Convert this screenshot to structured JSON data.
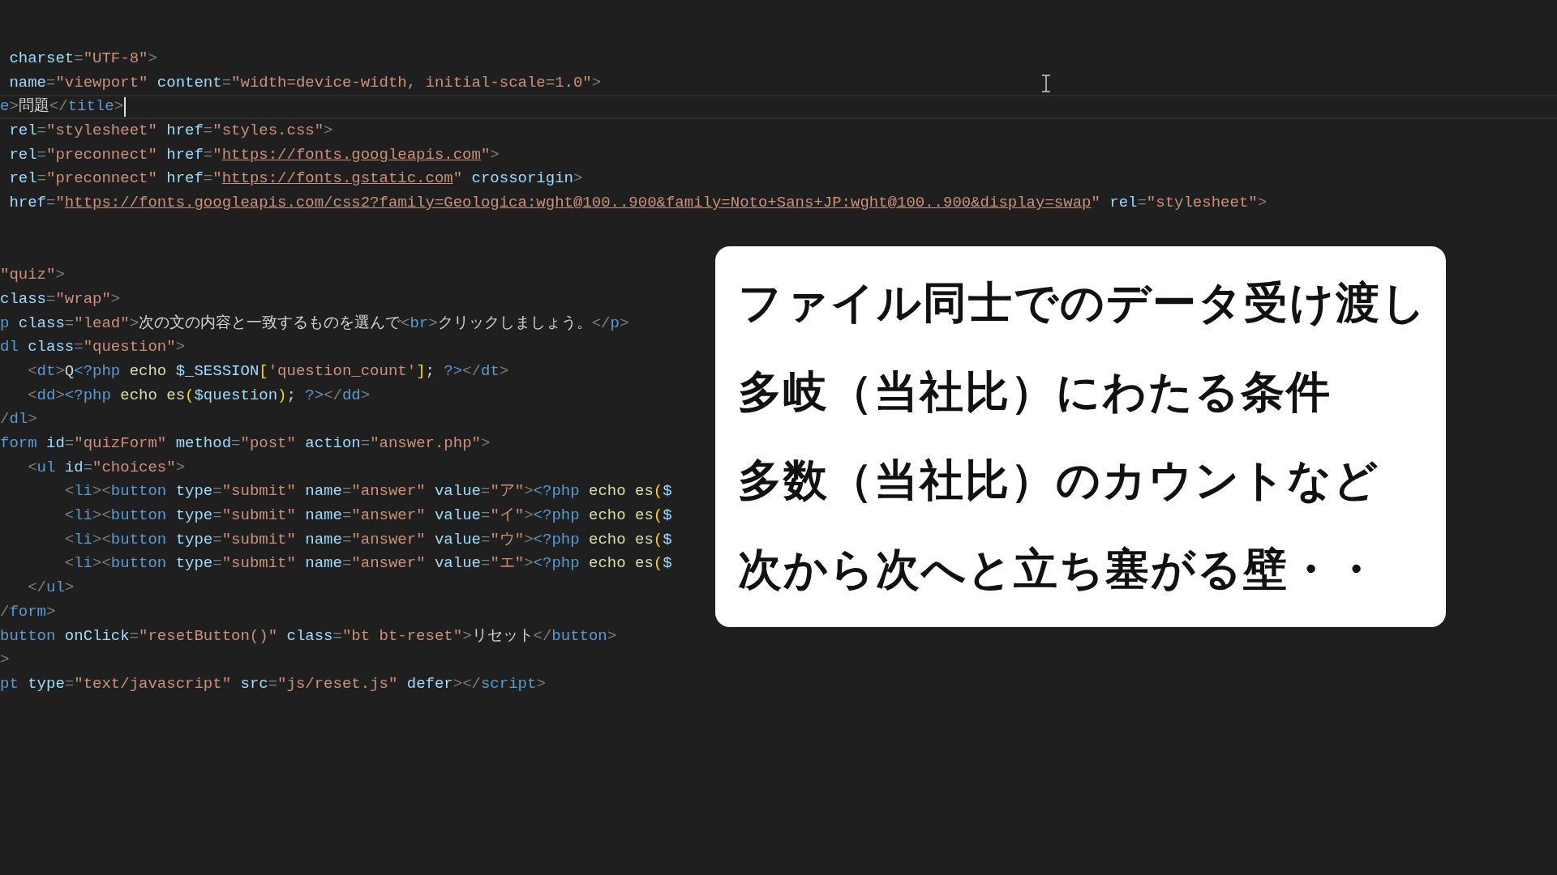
{
  "editor": {
    "code_blocks": [
      {
        "lines": [
          {
            "current": false,
            "segments": [
              {
                "kind": "attr",
                "text": " charset"
              },
              {
                "kind": "punct",
                "text": "="
              },
              {
                "kind": "str",
                "text": "\"UTF-8\""
              },
              {
                "kind": "punct",
                "text": ">"
              }
            ]
          },
          {
            "current": false,
            "segments": [
              {
                "kind": "attr",
                "text": " name"
              },
              {
                "kind": "punct",
                "text": "="
              },
              {
                "kind": "str",
                "text": "\"viewport\""
              },
              {
                "kind": "attr",
                "text": " content"
              },
              {
                "kind": "punct",
                "text": "="
              },
              {
                "kind": "str",
                "text": "\"width=device-width, initial-scale=1.0\""
              },
              {
                "kind": "punct",
                "text": ">"
              }
            ]
          },
          {
            "current": true,
            "segments": [
              {
                "kind": "tag",
                "text": "e"
              },
              {
                "kind": "punct",
                "text": ">"
              },
              {
                "kind": "plain",
                "text": "問題"
              },
              {
                "kind": "punct",
                "text": "</"
              },
              {
                "kind": "tag",
                "text": "title"
              },
              {
                "kind": "punct",
                "text": ">"
              }
            ]
          },
          {
            "current": false,
            "segments": [
              {
                "kind": "attr",
                "text": " rel"
              },
              {
                "kind": "punct",
                "text": "="
              },
              {
                "kind": "str",
                "text": "\"stylesheet\""
              },
              {
                "kind": "attr",
                "text": " href"
              },
              {
                "kind": "punct",
                "text": "="
              },
              {
                "kind": "str",
                "text": "\"styles.css\""
              },
              {
                "kind": "punct",
                "text": ">"
              }
            ]
          },
          {
            "current": false,
            "segments": [
              {
                "kind": "attr",
                "text": " rel"
              },
              {
                "kind": "punct",
                "text": "="
              },
              {
                "kind": "str",
                "text": "\"preconnect\""
              },
              {
                "kind": "attr",
                "text": " href"
              },
              {
                "kind": "punct",
                "text": "="
              },
              {
                "kind": "str",
                "text": "\""
              },
              {
                "kind": "link",
                "text": "https://fonts.googleapis.com"
              },
              {
                "kind": "str",
                "text": "\""
              },
              {
                "kind": "punct",
                "text": ">"
              }
            ]
          },
          {
            "current": false,
            "segments": [
              {
                "kind": "attr",
                "text": " rel"
              },
              {
                "kind": "punct",
                "text": "="
              },
              {
                "kind": "str",
                "text": "\"preconnect\""
              },
              {
                "kind": "attr",
                "text": " href"
              },
              {
                "kind": "punct",
                "text": "="
              },
              {
                "kind": "str",
                "text": "\""
              },
              {
                "kind": "link",
                "text": "https://fonts.gstatic.com"
              },
              {
                "kind": "str",
                "text": "\""
              },
              {
                "kind": "attr",
                "text": " crossorigin"
              },
              {
                "kind": "punct",
                "text": ">"
              }
            ]
          },
          {
            "current": false,
            "segments": [
              {
                "kind": "attr",
                "text": " href"
              },
              {
                "kind": "punct",
                "text": "="
              },
              {
                "kind": "str",
                "text": "\""
              },
              {
                "kind": "link",
                "text": "https://fonts.googleapis.com/css2?family=Geologica:wght@100..900&family=Noto+Sans+JP:wght@100..900&display=swap"
              },
              {
                "kind": "str",
                "text": "\""
              },
              {
                "kind": "attr",
                "text": " rel"
              },
              {
                "kind": "punct",
                "text": "="
              },
              {
                "kind": "str",
                "text": "\"stylesheet\""
              },
              {
                "kind": "punct",
                "text": ">"
              }
            ]
          }
        ]
      },
      {
        "lines": [
          {
            "current": false,
            "segments": [
              {
                "kind": "str",
                "text": "\"quiz\""
              },
              {
                "kind": "punct",
                "text": ">"
              }
            ]
          },
          {
            "current": false,
            "segments": [
              {
                "kind": "attr",
                "text": "class"
              },
              {
                "kind": "punct",
                "text": "="
              },
              {
                "kind": "str",
                "text": "\"wrap\""
              },
              {
                "kind": "punct",
                "text": ">"
              }
            ]
          },
          {
            "current": false,
            "segments": [
              {
                "kind": "tag",
                "text": "p"
              },
              {
                "kind": "attr",
                "text": " class"
              },
              {
                "kind": "punct",
                "text": "="
              },
              {
                "kind": "str",
                "text": "\"lead\""
              },
              {
                "kind": "punct",
                "text": ">"
              },
              {
                "kind": "plain",
                "text": "次の文の内容と一致するものを選んで"
              },
              {
                "kind": "punct",
                "text": "<"
              },
              {
                "kind": "tag",
                "text": "br"
              },
              {
                "kind": "punct",
                "text": ">"
              },
              {
                "kind": "plain",
                "text": "クリックしましょう。"
              },
              {
                "kind": "punct",
                "text": "</"
              },
              {
                "kind": "tag",
                "text": "p"
              },
              {
                "kind": "punct",
                "text": ">"
              }
            ]
          },
          {
            "current": false,
            "segments": [
              {
                "kind": "tag",
                "text": "dl"
              },
              {
                "kind": "attr",
                "text": " class"
              },
              {
                "kind": "punct",
                "text": "="
              },
              {
                "kind": "str",
                "text": "\"question\""
              },
              {
                "kind": "punct",
                "text": ">"
              }
            ]
          },
          {
            "current": false,
            "segments": [
              {
                "kind": "punct",
                "text": "   <"
              },
              {
                "kind": "tag",
                "text": "dt"
              },
              {
                "kind": "punct",
                "text": ">"
              },
              {
                "kind": "plain",
                "text": "Q"
              },
              {
                "kind": "php",
                "text": "<?php"
              },
              {
                "kind": "fn",
                "text": " echo"
              },
              {
                "kind": "var",
                "text": " $_SESSION"
              },
              {
                "kind": "brace",
                "text": "["
              },
              {
                "kind": "str",
                "text": "'question_count'"
              },
              {
                "kind": "brace",
                "text": "]"
              },
              {
                "kind": "plain",
                "text": ";"
              },
              {
                "kind": "php",
                "text": " ?>"
              },
              {
                "kind": "punct",
                "text": "</"
              },
              {
                "kind": "tag",
                "text": "dt"
              },
              {
                "kind": "punct",
                "text": ">"
              }
            ]
          },
          {
            "current": false,
            "segments": [
              {
                "kind": "punct",
                "text": "   <"
              },
              {
                "kind": "tag",
                "text": "dd"
              },
              {
                "kind": "punct",
                "text": ">"
              },
              {
                "kind": "php",
                "text": "<?php"
              },
              {
                "kind": "fn",
                "text": " echo es"
              },
              {
                "kind": "brace",
                "text": "("
              },
              {
                "kind": "var",
                "text": "$question"
              },
              {
                "kind": "brace",
                "text": ")"
              },
              {
                "kind": "plain",
                "text": ";"
              },
              {
                "kind": "php",
                "text": " ?>"
              },
              {
                "kind": "punct",
                "text": "</"
              },
              {
                "kind": "tag",
                "text": "dd"
              },
              {
                "kind": "punct",
                "text": ">"
              }
            ]
          },
          {
            "current": false,
            "segments": [
              {
                "kind": "punct",
                "text": "/"
              },
              {
                "kind": "tag",
                "text": "dl"
              },
              {
                "kind": "punct",
                "text": ">"
              }
            ]
          },
          {
            "current": false,
            "segments": [
              {
                "kind": "tag",
                "text": "form"
              },
              {
                "kind": "attr",
                "text": " id"
              },
              {
                "kind": "punct",
                "text": "="
              },
              {
                "kind": "str",
                "text": "\"quizForm\""
              },
              {
                "kind": "attr",
                "text": " method"
              },
              {
                "kind": "punct",
                "text": "="
              },
              {
                "kind": "str",
                "text": "\"post\""
              },
              {
                "kind": "attr",
                "text": " action"
              },
              {
                "kind": "punct",
                "text": "="
              },
              {
                "kind": "str",
                "text": "\"answer.php\""
              },
              {
                "kind": "punct",
                "text": ">"
              }
            ]
          },
          {
            "current": false,
            "segments": [
              {
                "kind": "punct",
                "text": "   <"
              },
              {
                "kind": "tag",
                "text": "ul"
              },
              {
                "kind": "attr",
                "text": " id"
              },
              {
                "kind": "punct",
                "text": "="
              },
              {
                "kind": "str",
                "text": "\"choices\""
              },
              {
                "kind": "punct",
                "text": ">"
              }
            ]
          },
          {
            "current": false,
            "segments": [
              {
                "kind": "punct",
                "text": "       <"
              },
              {
                "kind": "tag",
                "text": "li"
              },
              {
                "kind": "punct",
                "text": "><"
              },
              {
                "kind": "tag",
                "text": "button"
              },
              {
                "kind": "attr",
                "text": " type"
              },
              {
                "kind": "punct",
                "text": "="
              },
              {
                "kind": "str",
                "text": "\"submit\""
              },
              {
                "kind": "attr",
                "text": " name"
              },
              {
                "kind": "punct",
                "text": "="
              },
              {
                "kind": "str",
                "text": "\"answer\""
              },
              {
                "kind": "attr",
                "text": " value"
              },
              {
                "kind": "punct",
                "text": "="
              },
              {
                "kind": "str",
                "text": "\"ア\""
              },
              {
                "kind": "punct",
                "text": ">"
              },
              {
                "kind": "php",
                "text": "<?php"
              },
              {
                "kind": "fn",
                "text": " echo es"
              },
              {
                "kind": "brace",
                "text": "("
              },
              {
                "kind": "var",
                "text": "$"
              }
            ]
          },
          {
            "current": false,
            "segments": [
              {
                "kind": "punct",
                "text": "       <"
              },
              {
                "kind": "tag",
                "text": "li"
              },
              {
                "kind": "punct",
                "text": "><"
              },
              {
                "kind": "tag",
                "text": "button"
              },
              {
                "kind": "attr",
                "text": " type"
              },
              {
                "kind": "punct",
                "text": "="
              },
              {
                "kind": "str",
                "text": "\"submit\""
              },
              {
                "kind": "attr",
                "text": " name"
              },
              {
                "kind": "punct",
                "text": "="
              },
              {
                "kind": "str",
                "text": "\"answer\""
              },
              {
                "kind": "attr",
                "text": " value"
              },
              {
                "kind": "punct",
                "text": "="
              },
              {
                "kind": "str",
                "text": "\"イ\""
              },
              {
                "kind": "punct",
                "text": ">"
              },
              {
                "kind": "php",
                "text": "<?php"
              },
              {
                "kind": "fn",
                "text": " echo es"
              },
              {
                "kind": "brace",
                "text": "("
              },
              {
                "kind": "var",
                "text": "$"
              }
            ]
          },
          {
            "current": false,
            "segments": [
              {
                "kind": "punct",
                "text": "       <"
              },
              {
                "kind": "tag",
                "text": "li"
              },
              {
                "kind": "punct",
                "text": "><"
              },
              {
                "kind": "tag",
                "text": "button"
              },
              {
                "kind": "attr",
                "text": " type"
              },
              {
                "kind": "punct",
                "text": "="
              },
              {
                "kind": "str",
                "text": "\"submit\""
              },
              {
                "kind": "attr",
                "text": " name"
              },
              {
                "kind": "punct",
                "text": "="
              },
              {
                "kind": "str",
                "text": "\"answer\""
              },
              {
                "kind": "attr",
                "text": " value"
              },
              {
                "kind": "punct",
                "text": "="
              },
              {
                "kind": "str",
                "text": "\"ウ\""
              },
              {
                "kind": "punct",
                "text": ">"
              },
              {
                "kind": "php",
                "text": "<?php"
              },
              {
                "kind": "fn",
                "text": " echo es"
              },
              {
                "kind": "brace",
                "text": "("
              },
              {
                "kind": "var",
                "text": "$"
              }
            ]
          },
          {
            "current": false,
            "segments": [
              {
                "kind": "punct",
                "text": "       <"
              },
              {
                "kind": "tag",
                "text": "li"
              },
              {
                "kind": "punct",
                "text": "><"
              },
              {
                "kind": "tag",
                "text": "button"
              },
              {
                "kind": "attr",
                "text": " type"
              },
              {
                "kind": "punct",
                "text": "="
              },
              {
                "kind": "str",
                "text": "\"submit\""
              },
              {
                "kind": "attr",
                "text": " name"
              },
              {
                "kind": "punct",
                "text": "="
              },
              {
                "kind": "str",
                "text": "\"answer\""
              },
              {
                "kind": "attr",
                "text": " value"
              },
              {
                "kind": "punct",
                "text": "="
              },
              {
                "kind": "str",
                "text": "\"エ\""
              },
              {
                "kind": "punct",
                "text": ">"
              },
              {
                "kind": "php",
                "text": "<?php"
              },
              {
                "kind": "fn",
                "text": " echo es"
              },
              {
                "kind": "brace",
                "text": "("
              },
              {
                "kind": "var",
                "text": "$"
              }
            ]
          },
          {
            "current": false,
            "segments": [
              {
                "kind": "punct",
                "text": "   </"
              },
              {
                "kind": "tag",
                "text": "ul"
              },
              {
                "kind": "punct",
                "text": ">"
              }
            ]
          },
          {
            "current": false,
            "segments": [
              {
                "kind": "punct",
                "text": "/"
              },
              {
                "kind": "tag",
                "text": "form"
              },
              {
                "kind": "punct",
                "text": ">"
              }
            ]
          },
          {
            "current": false,
            "segments": [
              {
                "kind": "tag",
                "text": "button"
              },
              {
                "kind": "attr",
                "text": " onClick"
              },
              {
                "kind": "punct",
                "text": "="
              },
              {
                "kind": "str",
                "text": "\"resetButton()\""
              },
              {
                "kind": "attr",
                "text": " class"
              },
              {
                "kind": "punct",
                "text": "="
              },
              {
                "kind": "str",
                "text": "\"bt bt-reset\""
              },
              {
                "kind": "punct",
                "text": ">"
              },
              {
                "kind": "plain",
                "text": "リセット"
              },
              {
                "kind": "punct",
                "text": "</"
              },
              {
                "kind": "tag",
                "text": "button"
              },
              {
                "kind": "punct",
                "text": ">"
              }
            ]
          },
          {
            "current": false,
            "segments": [
              {
                "kind": "punct",
                "text": ">"
              }
            ]
          },
          {
            "current": false,
            "segments": [
              {
                "kind": "tag",
                "text": "pt"
              },
              {
                "kind": "attr",
                "text": " type"
              },
              {
                "kind": "punct",
                "text": "="
              },
              {
                "kind": "str",
                "text": "\"text/javascript\""
              },
              {
                "kind": "attr",
                "text": " src"
              },
              {
                "kind": "punct",
                "text": "="
              },
              {
                "kind": "str",
                "text": "\"js/reset.js\""
              },
              {
                "kind": "attr",
                "text": " defer"
              },
              {
                "kind": "punct",
                "text": "></"
              },
              {
                "kind": "tag",
                "text": "script"
              },
              {
                "kind": "punct",
                "text": ">"
              }
            ]
          }
        ]
      }
    ]
  },
  "overlay_card": {
    "lines": [
      "ファイル同士でのデータ受け渡し",
      "多岐（当社比）にわたる条件",
      "多数（当社比）のカウントなど",
      "次から次へと立ち塞がる壁・・"
    ]
  }
}
